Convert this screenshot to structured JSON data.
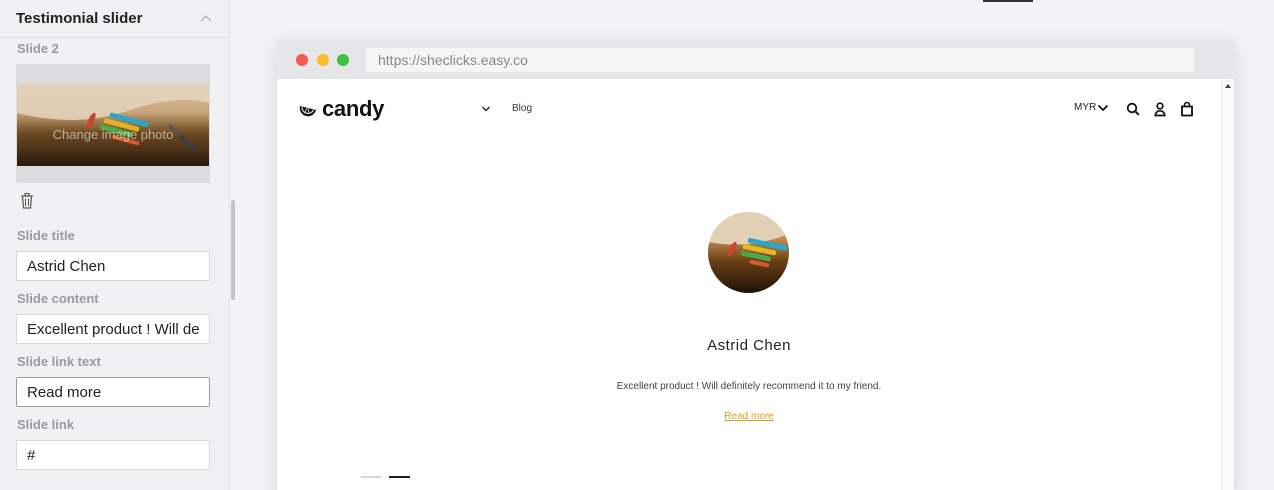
{
  "panel": {
    "title": "Testimonial slider",
    "slide_heading": "Slide 2",
    "image_caption": "Change image photo",
    "fields": {
      "title_label": "Slide title",
      "title_value": "Astrid Chen",
      "content_label": "Slide content",
      "content_value": "Excellent product ! Will de",
      "link_text_label": "Slide link text",
      "link_text_value": "Read more",
      "link_label": "Slide link",
      "link_value": "#"
    },
    "icons": {
      "collapse": "chevron-up-icon",
      "delete": "trash-icon"
    }
  },
  "browser": {
    "url": "https://sheclicks.easy.co",
    "window_controls": [
      "close",
      "minimize",
      "maximize"
    ]
  },
  "site": {
    "logo_text": "candy",
    "nav": {
      "blog": "Blog"
    },
    "currency": "MYR",
    "icons": [
      "search-icon",
      "account-icon",
      "cart-icon"
    ]
  },
  "testimonial": {
    "name": "Astrid Chen",
    "content": "Excellent product ! Will definitely recommend it to my friend.",
    "link_text": "Read more",
    "active_slide": 2,
    "slide_count": 2
  },
  "colors": {
    "link_accent": "#d7a317",
    "dot_red": "#f65a52",
    "dot_yellow": "#f7bd2c",
    "dot_green": "#3ec141"
  }
}
